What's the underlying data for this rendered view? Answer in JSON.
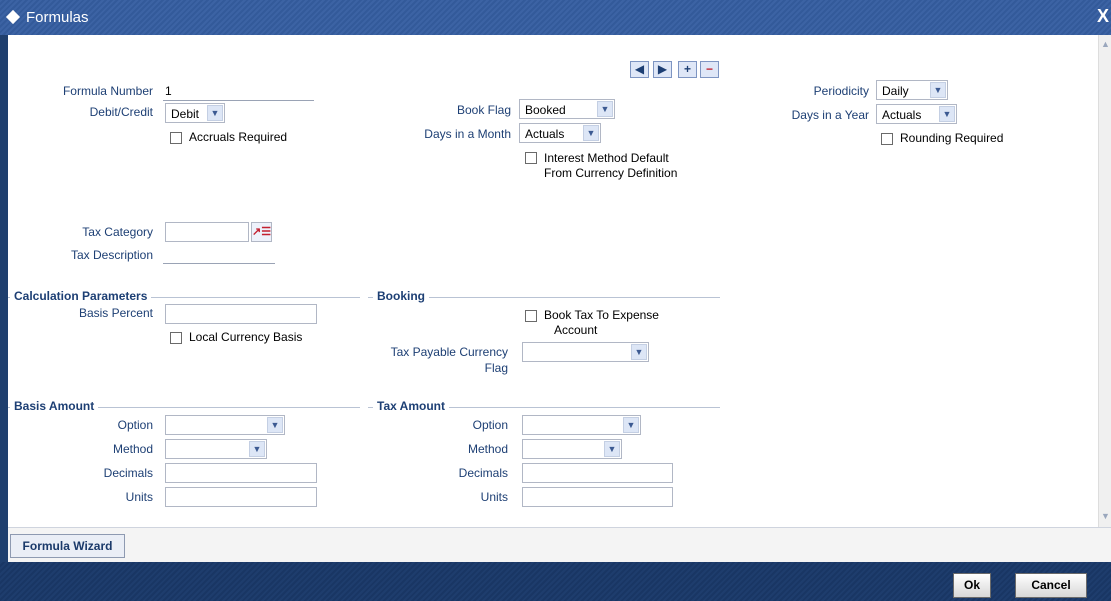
{
  "window": {
    "title": "Formulas",
    "close": "X"
  },
  "nav": {
    "prev": "◀",
    "next": "▶",
    "add": "+",
    "remove": "−"
  },
  "fields": {
    "formula_number_label": "Formula Number",
    "formula_number_value": "1",
    "debit_credit_label": "Debit/Credit",
    "debit_credit_value": "Debit",
    "accruals_required_label": "Accruals Required",
    "book_flag_label": "Book Flag",
    "book_flag_value": "Booked",
    "days_in_month_label": "Days in a Month",
    "days_in_month_value": "Actuals",
    "interest_method_label_line1": "Interest Method Default",
    "interest_method_label_line2": "From Currency Definition",
    "periodicity_label": "Periodicity",
    "periodicity_value": "Daily",
    "days_in_year_label": "Days in a Year",
    "days_in_year_value": "Actuals",
    "rounding_required_label": "Rounding Required",
    "tax_category_label": "Tax Category",
    "tax_category_value": "",
    "tax_description_label": "Tax Description"
  },
  "calculation": {
    "title": "Calculation Parameters",
    "basis_percent_label": "Basis Percent",
    "local_currency_basis_label": "Local Currency Basis"
  },
  "booking": {
    "title": "Booking",
    "book_tax_label_line1": "Book Tax To Expense",
    "book_tax_label_line2": "Account",
    "tax_payable_label_line1": "Tax Payable Currency",
    "tax_payable_label_line2": "Flag",
    "tax_payable_value": ""
  },
  "basis_amount": {
    "title": "Basis Amount",
    "option_label": "Option",
    "method_label": "Method",
    "decimals_label": "Decimals",
    "units_label": "Units"
  },
  "tax_amount": {
    "title": "Tax Amount",
    "option_label": "Option",
    "method_label": "Method",
    "decimals_label": "Decimals",
    "units_label": "Units"
  },
  "wizard": {
    "label": "Formula Wizard"
  },
  "footer": {
    "ok": "Ok",
    "cancel": "Cancel"
  },
  "icons": {
    "dropdown": "chevron-down-icon",
    "lov": "list-of-values-icon"
  }
}
